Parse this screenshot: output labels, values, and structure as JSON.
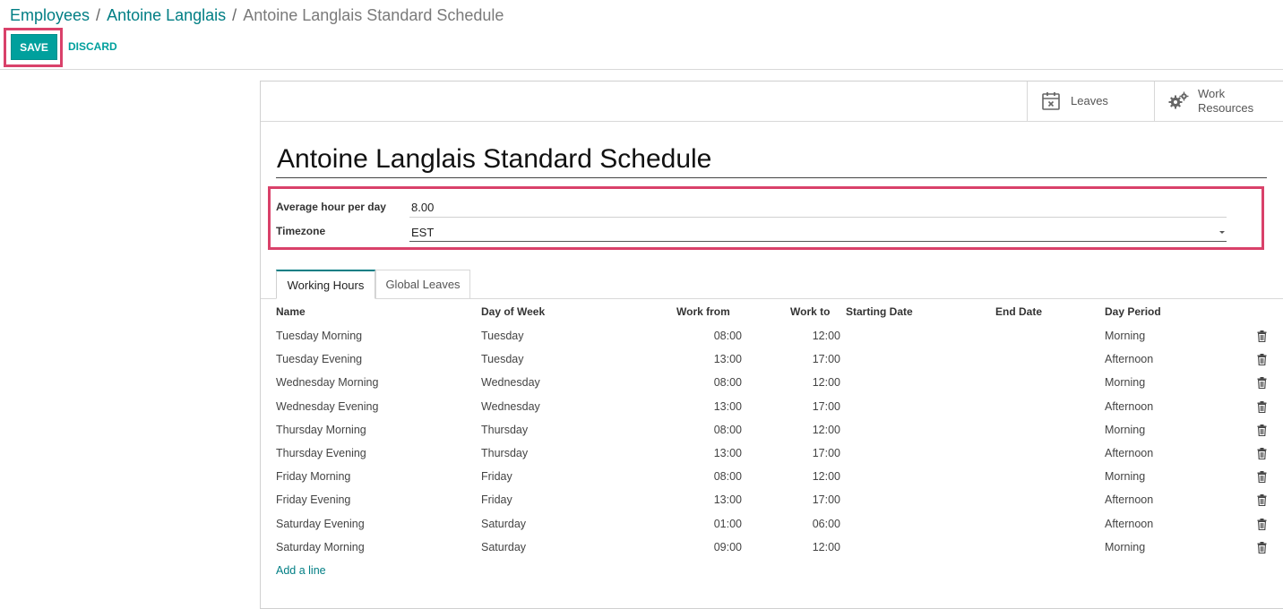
{
  "breadcrumb": {
    "items": [
      "Employees",
      "Antoine Langlais"
    ],
    "active": "Antoine Langlais Standard Schedule",
    "separator": "/"
  },
  "toolbar": {
    "save_label": "SAVE",
    "discard_label": "DISCARD"
  },
  "stat_buttons": {
    "leaves_label": "Leaves",
    "resources_line1": "Work",
    "resources_line2": "Resources"
  },
  "form": {
    "title": "Antoine Langlais Standard Schedule",
    "avg_hours_label": "Average hour per day",
    "avg_hours_value": "8.00",
    "timezone_label": "Timezone",
    "timezone_value": "EST"
  },
  "tabs": {
    "working_hours": "Working Hours",
    "global_leaves": "Global Leaves"
  },
  "table": {
    "headers": {
      "name": "Name",
      "day": "Day of Week",
      "from": "Work from",
      "to": "Work to",
      "start": "Starting Date",
      "end": "End Date",
      "period": "Day Period"
    },
    "rows": [
      {
        "name": "Tuesday Morning",
        "day": "Tuesday",
        "from": "08:00",
        "to": "12:00",
        "period": "Morning"
      },
      {
        "name": "Tuesday Evening",
        "day": "Tuesday",
        "from": "13:00",
        "to": "17:00",
        "period": "Afternoon"
      },
      {
        "name": "Wednesday Morning",
        "day": "Wednesday",
        "from": "08:00",
        "to": "12:00",
        "period": "Morning"
      },
      {
        "name": "Wednesday Evening",
        "day": "Wednesday",
        "from": "13:00",
        "to": "17:00",
        "period": "Afternoon"
      },
      {
        "name": "Thursday Morning",
        "day": "Thursday",
        "from": "08:00",
        "to": "12:00",
        "period": "Morning"
      },
      {
        "name": "Thursday Evening",
        "day": "Thursday",
        "from": "13:00",
        "to": "17:00",
        "period": "Afternoon"
      },
      {
        "name": "Friday Morning",
        "day": "Friday",
        "from": "08:00",
        "to": "12:00",
        "period": "Morning"
      },
      {
        "name": "Friday Evening",
        "day": "Friday",
        "from": "13:00",
        "to": "17:00",
        "period": "Afternoon"
      },
      {
        "name": "Saturday Evening",
        "day": "Saturday",
        "from": "01:00",
        "to": "06:00",
        "period": "Afternoon"
      },
      {
        "name": "Saturday Morning",
        "day": "Saturday",
        "from": "09:00",
        "to": "12:00",
        "period": "Morning"
      }
    ],
    "add_line": "Add a line"
  },
  "icons": {
    "leaves": "calendar-x-icon",
    "resources": "gears-icon",
    "delete": "trash-icon",
    "dropdown": "caret-down-icon"
  },
  "colors": {
    "accent": "#00a09d",
    "link": "#017e84",
    "highlight": "#d9416a"
  }
}
